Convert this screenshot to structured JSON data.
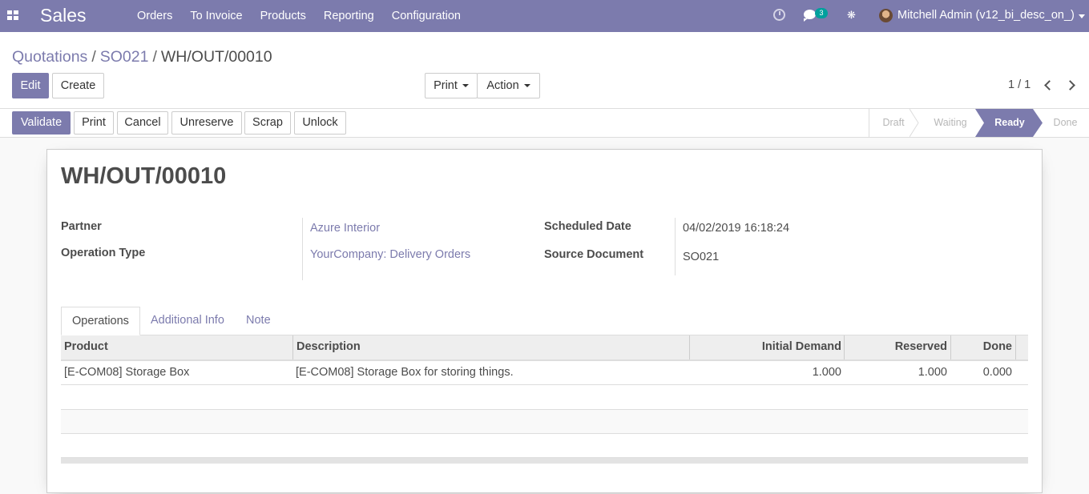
{
  "navbar": {
    "apps_icon": "apps-grid-icon",
    "brand": "Sales",
    "menu": [
      "Orders",
      "To Invoice",
      "Products",
      "Reporting",
      "Configuration"
    ],
    "activity_icon": "clock-icon",
    "messages_icon": "chat-icon",
    "messages_count": "3",
    "debug_icon": "bug-icon",
    "user_name": "Mitchell Admin (v12_bi_desc_on_)",
    "brand_color": "#7c7bad"
  },
  "breadcrumb": {
    "items": [
      "Quotations",
      "SO021"
    ],
    "separator": "/",
    "current": "WH/OUT/00010"
  },
  "buttons": {
    "edit": "Edit",
    "create": "Create",
    "print": "Print",
    "action": "Action"
  },
  "pager": {
    "value": "1 / 1"
  },
  "statusbar": {
    "buttons": [
      "Validate",
      "Print",
      "Cancel",
      "Unreserve",
      "Scrap",
      "Unlock"
    ],
    "stages": [
      "Draft",
      "Waiting",
      "Ready",
      "Done"
    ],
    "active_stage": "Ready"
  },
  "record": {
    "title": "WH/OUT/00010",
    "fields": {
      "partner_label": "Partner",
      "partner_value": "Azure Interior",
      "operation_type_label": "Operation Type",
      "operation_type_value": "YourCompany: Delivery Orders",
      "scheduled_date_label": "Scheduled Date",
      "scheduled_date_value": "04/02/2019 16:18:24",
      "source_document_label": "Source Document",
      "source_document_value": "SO021"
    }
  },
  "tabs": [
    "Operations",
    "Additional Info",
    "Note"
  ],
  "table": {
    "columns": [
      "Product",
      "Description",
      "Initial Demand",
      "Reserved",
      "Done"
    ],
    "rows": [
      {
        "product": "[E-COM08] Storage Box",
        "description": "[E-COM08] Storage Box for storing things.",
        "initial_demand": "1.000",
        "reserved": "1.000",
        "done": "0.000"
      }
    ]
  }
}
